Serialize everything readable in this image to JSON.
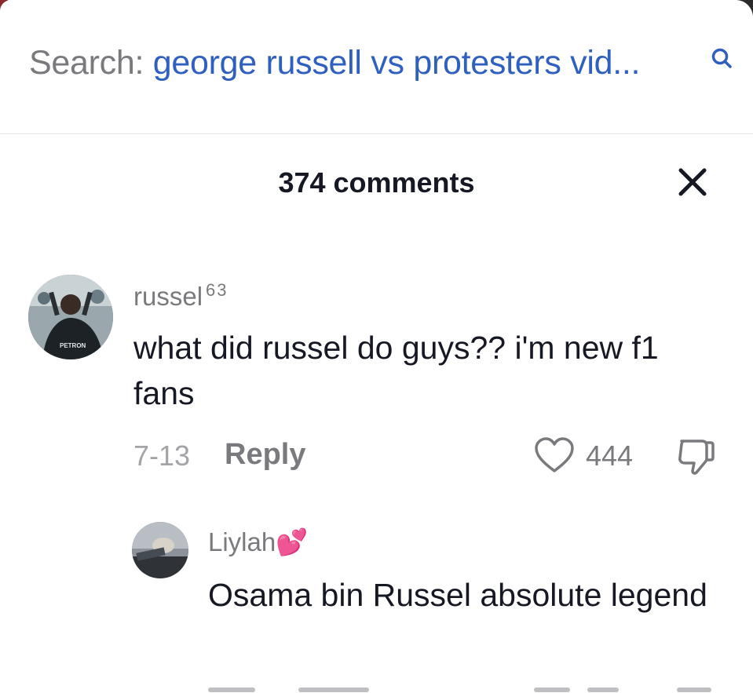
{
  "search": {
    "prefix": "Search:",
    "query": "george russell vs protesters vid..."
  },
  "comments_panel": {
    "count_label": "374 comments"
  },
  "comments": [
    {
      "username": "russel",
      "username_superscript": "63",
      "text": "what did russel do guys?? i'm new f1 fans",
      "date": "7-13",
      "reply_label": "Reply",
      "likes": "444"
    }
  ],
  "replies": [
    {
      "username": "Liylah",
      "username_emoji": "💕",
      "text": "Osama bin Russel absolute legend"
    }
  ],
  "colors": {
    "search_query": "#2f5fbf",
    "muted_text": "#7a7a7e",
    "primary_text": "#161823"
  }
}
